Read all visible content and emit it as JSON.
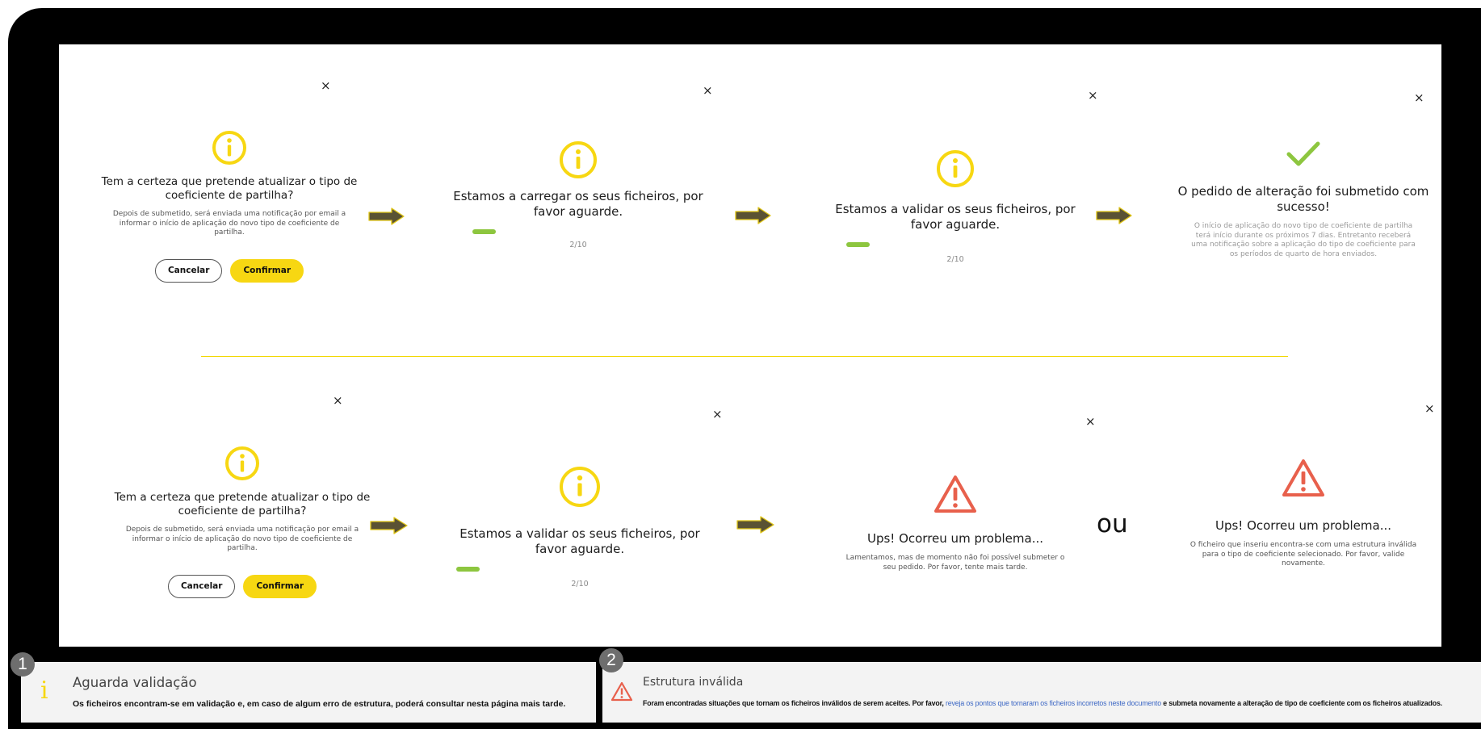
{
  "row1": {
    "confirm": {
      "title": "Tem a certeza que pretende atualizar o tipo de coeficiente de partilha?",
      "description": "Depois de submetido, será enviada uma notificação por email a informar o início de aplicação do novo tipo de coeficiente de partilha.",
      "cancel_label": "Cancelar",
      "confirm_label": "Confirmar"
    },
    "uploading": {
      "title": "Estamos a carregar os seus ficheiros, por favor aguarde.",
      "counter": "2/10",
      "progress": 0.1
    },
    "validating": {
      "title": "Estamos a validar os seus ficheiros, por favor aguarde.",
      "counter": "2/10",
      "progress": 0.1
    },
    "success": {
      "title": "O pedido de alteração foi submetido com sucesso!",
      "description": "O início de aplicação do novo tipo de coeficiente de partilha terá início durante os próximos 7 dias. Entretanto receberá uma notificação sobre a aplicação do tipo de coeficiente para os períodos de quarto de hora enviados."
    }
  },
  "row2": {
    "confirm": {
      "title": "Tem a certeza que pretende atualizar o tipo de coeficiente de partilha?",
      "description": "Depois de submetido, será enviada uma notificação por email a informar o início de aplicação do novo tipo de coeficiente de partilha.",
      "cancel_label": "Cancelar",
      "confirm_label": "Confirmar"
    },
    "validating": {
      "title": "Estamos a validar os seus ficheiros, por favor aguarde.",
      "counter": "2/10",
      "progress": 0.1
    },
    "error_generic": {
      "title": "Ups! Ocorreu um problema...",
      "description": "Lamentamos, mas de momento não foi possível submeter o seu pedido. Por favor, tente mais tarde."
    },
    "separator": "ou",
    "error_invalid": {
      "title": "Ups! Ocorreu um problema...",
      "description": "O ficheiro que inseriu encontra-se com uma estrutura inválida para o tipo de coeficiente selecionado. Por favor, valide novamente."
    }
  },
  "notices": {
    "pending": {
      "badge": "1",
      "icon_glyph": "i",
      "title": "Aguarda validação",
      "body": "Os ficheiros encontram-se em validação e, em caso de algum erro de estrutura, poderá consultar nesta página mais tarde."
    },
    "invalid": {
      "badge": "2",
      "title": "Estrutura inválida",
      "body_before": "Foram encontradas situações que tornam os ficheiros inválidos de serem aceites. Por favor,",
      "link": "reveja os pontos que tornaram os ficheiros incorretos neste documento",
      "body_after": "e submeta novamente a alteração de tipo de coeficiente com os ficheiros atualizados."
    }
  },
  "close_glyph": "×",
  "colors": {
    "accent_yellow": "#f7d712",
    "success_green": "#8dc63f",
    "error_red": "#e8604c",
    "arrow_fill": "#5a5233",
    "arrow_stroke": "#e0c514",
    "divider": "#f2d700"
  },
  "icons": {
    "info": "info-circle-icon",
    "success": "checkmark-icon",
    "error": "warning-triangle-icon",
    "flow": "arrow-right-icon",
    "close": "close-icon"
  }
}
